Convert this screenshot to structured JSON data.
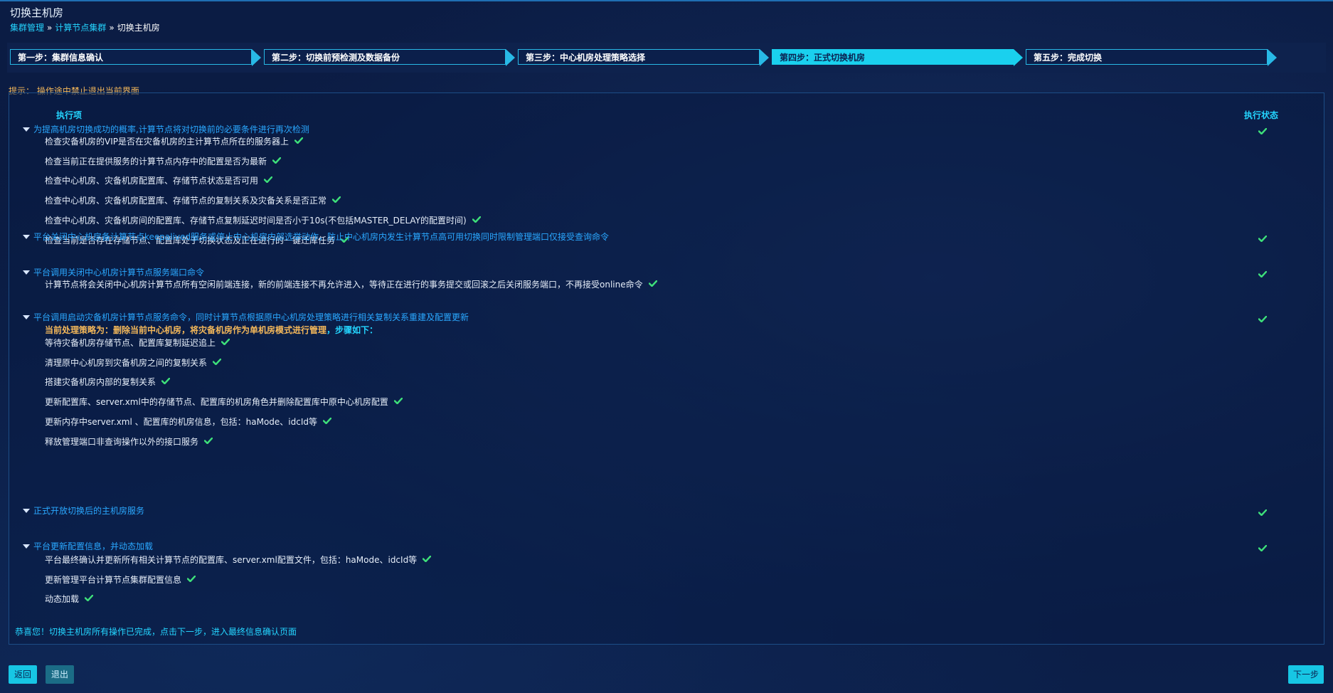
{
  "page": {
    "title": "切换主机房",
    "breadcrumb": [
      "集群管理",
      "计算节点集群",
      "切换主机房"
    ],
    "breadcrumb_sep": "»"
  },
  "steps": [
    {
      "label": "第一步：集群信息确认",
      "active": false
    },
    {
      "label": "第二步：切换前预检测及数据备份",
      "active": false
    },
    {
      "label": "第三步：中心机房处理策略选择",
      "active": false
    },
    {
      "label": "第四步：正式切换机房",
      "active": true
    },
    {
      "label": "第五步：完成切换",
      "active": false
    }
  ],
  "tip": "提示：  操作途中禁止退出当前界面",
  "table": {
    "col_item": "执行项",
    "col_status": "执行状态"
  },
  "groups": [
    {
      "title": "为提高机房切换成功的概率,计算节点将对切换前的必要条件进行再次检测",
      "status": "done",
      "items": [
        "检查灾备机房的VIP是否在灾备机房的主计算节点所在的服务器上",
        "检查当前正在提供服务的计算节点内存中的配置是否为最新",
        "检查中心机房、灾备机房配置库、存储节点状态是否可用",
        "检查中心机房、灾备机房配置库、存储节点的复制关系及灾备关系是否正常",
        "检查中心机房、灾备机房间的配置库、存储节点复制延迟时间是否小于10s(不包括MASTER_DELAY的配置时间)",
        "检查当前是否存在存储节点、配置库处于切换状态及正在进行的一键迁库任务"
      ]
    },
    {
      "title": "平台关闭中心机房备计算节点keepalived服务或停止中心机房内部选举动作，防止中心机房内发生计算节点高可用切换同时限制管理端口仅接受查询命令",
      "status": "done",
      "items": []
    },
    {
      "title": "平台调用关闭中心机房计算节点服务端口命令",
      "status": "done",
      "items": [
        "计算节点将会关闭中心机房计算节点所有空闲前端连接，新的前端连接不再允许进入，等待正在进行的事务提交或回滚之后关闭服务端口，不再接受online命令"
      ]
    },
    {
      "title": "平台调用启动灾备机房计算节点服务命令，同时计算节点根据原中心机房处理策略进行相关复制关系重建及配置更新",
      "status": "done",
      "strategy": {
        "highlight": "当前处理策略为：删除当前中心机房，将灾备机房作为单机房模式进行管理",
        "rest": "，步骤如下："
      },
      "items": [
        "等待灾备机房存储节点、配置库复制延迟追上",
        "清理原中心机房到灾备机房之间的复制关系",
        "搭建灾备机房内部的复制关系",
        "更新配置库、server.xml中的存储节点、配置库的机房角色并删除配置库中原中心机房配置",
        "更新内存中server.xml 、配置库的机房信息，包括：haMode、idcId等",
        "释放管理端口非查询操作以外的接口服务"
      ]
    },
    {
      "title": "正式开放切换后的主机房服务",
      "status": "done",
      "items": []
    },
    {
      "title": "平台更新配置信息，并动态加载",
      "status": "done",
      "items": [
        "平台最终确认并更新所有相关计算节点的配置库、server.xml配置文件，包括：haMode、idcId等",
        "更新管理平台计算节点集群配置信息",
        "动态加载"
      ]
    }
  ],
  "congrats": "恭喜您！切换主机房所有操作已完成，点击下一步，进入最终信息确认页面",
  "buttons": {
    "back": "返回",
    "exit": "退出",
    "next": "下一步"
  },
  "colors": {
    "accent": "#1ad0ee",
    "check": "#3ee07a",
    "warning": "#f4b85a",
    "link": "#2aa8ff"
  },
  "icons": {
    "check": "check-icon",
    "caret": "caret-down-icon"
  }
}
